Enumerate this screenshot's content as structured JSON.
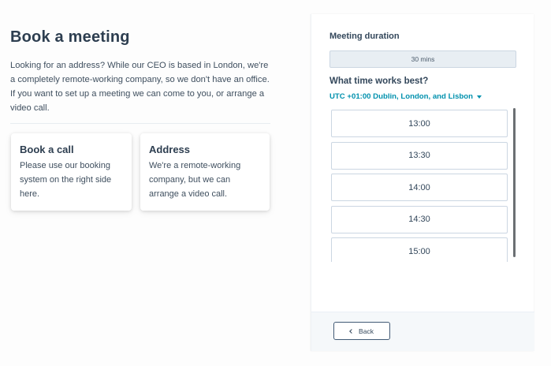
{
  "left": {
    "title": "Book a meeting",
    "intro": "Looking for an address? While our CEO is based in London, we're a completely remote-working company, so we don't have an office. If you want to set up a meeting we can come to you, or arrange a video call.",
    "cards": [
      {
        "title": "Book a call",
        "body": "Please use our booking system on the right side here."
      },
      {
        "title": "Address",
        "body": "We're a remote-working company, but we can arrange a video call."
      }
    ]
  },
  "scheduler": {
    "duration_label": "Meeting duration",
    "duration_value": "30 mins",
    "time_label": "What time works best?",
    "timezone": "UTC +01:00 Dublin, London, and Lisbon",
    "slots": [
      "13:00",
      "13:30",
      "14:00",
      "14:30",
      "15:00"
    ],
    "back_label": "Back"
  },
  "colors": {
    "accent": "#0091ae",
    "heading": "#2d3e50",
    "border": "#cbd6e2"
  }
}
